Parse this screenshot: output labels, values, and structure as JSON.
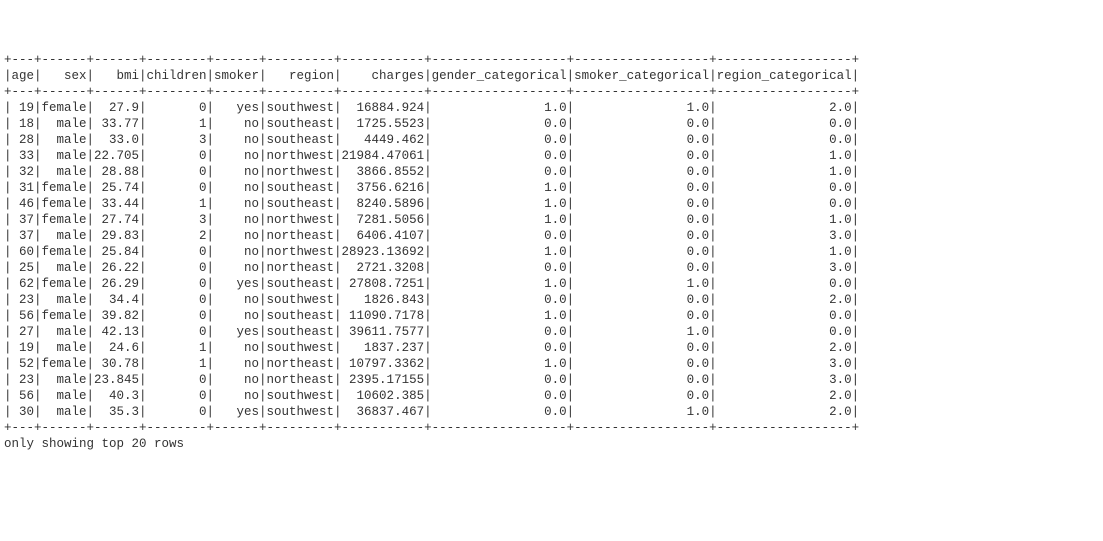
{
  "chart_data": {
    "type": "table",
    "columns": [
      "age",
      "sex",
      "bmi",
      "children",
      "smoker",
      "region",
      "charges",
      "gender_categorical",
      "smoker_categorical",
      "region_categorical"
    ],
    "rows": [
      [
        "19",
        "female",
        "27.9",
        "0",
        "yes",
        "southwest",
        "16884.924",
        "1.0",
        "1.0",
        "2.0"
      ],
      [
        "18",
        "male",
        "33.77",
        "1",
        "no",
        "southeast",
        "1725.5523",
        "0.0",
        "0.0",
        "0.0"
      ],
      [
        "28",
        "male",
        "33.0",
        "3",
        "no",
        "southeast",
        "4449.462",
        "0.0",
        "0.0",
        "0.0"
      ],
      [
        "33",
        "male",
        "22.705",
        "0",
        "no",
        "northwest",
        "21984.47061",
        "0.0",
        "0.0",
        "1.0"
      ],
      [
        "32",
        "male",
        "28.88",
        "0",
        "no",
        "northwest",
        "3866.8552",
        "0.0",
        "0.0",
        "1.0"
      ],
      [
        "31",
        "female",
        "25.74",
        "0",
        "no",
        "southeast",
        "3756.6216",
        "1.0",
        "0.0",
        "0.0"
      ],
      [
        "46",
        "female",
        "33.44",
        "1",
        "no",
        "southeast",
        "8240.5896",
        "1.0",
        "0.0",
        "0.0"
      ],
      [
        "37",
        "female",
        "27.74",
        "3",
        "no",
        "northwest",
        "7281.5056",
        "1.0",
        "0.0",
        "1.0"
      ],
      [
        "37",
        "male",
        "29.83",
        "2",
        "no",
        "northeast",
        "6406.4107",
        "0.0",
        "0.0",
        "3.0"
      ],
      [
        "60",
        "female",
        "25.84",
        "0",
        "no",
        "northwest",
        "28923.13692",
        "1.0",
        "0.0",
        "1.0"
      ],
      [
        "25",
        "male",
        "26.22",
        "0",
        "no",
        "northeast",
        "2721.3208",
        "0.0",
        "0.0",
        "3.0"
      ],
      [
        "62",
        "female",
        "26.29",
        "0",
        "yes",
        "southeast",
        "27808.7251",
        "1.0",
        "1.0",
        "0.0"
      ],
      [
        "23",
        "male",
        "34.4",
        "0",
        "no",
        "southwest",
        "1826.843",
        "0.0",
        "0.0",
        "2.0"
      ],
      [
        "56",
        "female",
        "39.82",
        "0",
        "no",
        "southeast",
        "11090.7178",
        "1.0",
        "0.0",
        "0.0"
      ],
      [
        "27",
        "male",
        "42.13",
        "0",
        "yes",
        "southeast",
        "39611.7577",
        "0.0",
        "1.0",
        "0.0"
      ],
      [
        "19",
        "male",
        "24.6",
        "1",
        "no",
        "southwest",
        "1837.237",
        "0.0",
        "0.0",
        "2.0"
      ],
      [
        "52",
        "female",
        "30.78",
        "1",
        "no",
        "northeast",
        "10797.3362",
        "1.0",
        "0.0",
        "3.0"
      ],
      [
        "23",
        "male",
        "23.845",
        "0",
        "no",
        "northeast",
        "2395.17155",
        "0.0",
        "0.0",
        "3.0"
      ],
      [
        "56",
        "male",
        "40.3",
        "0",
        "no",
        "southwest",
        "10602.385",
        "0.0",
        "0.0",
        "2.0"
      ],
      [
        "30",
        "male",
        "35.3",
        "0",
        "yes",
        "southwest",
        "36837.467",
        "0.0",
        "1.0",
        "2.0"
      ]
    ]
  },
  "column_widths": {
    "age": 3,
    "sex": 6,
    "bmi": 6,
    "children": 8,
    "smoker": 6,
    "region": 9,
    "charges": 11,
    "gender_categorical": 18,
    "smoker_categorical": 18,
    "region_categorical": 18
  },
  "footer_text": "only showing top 20 rows"
}
